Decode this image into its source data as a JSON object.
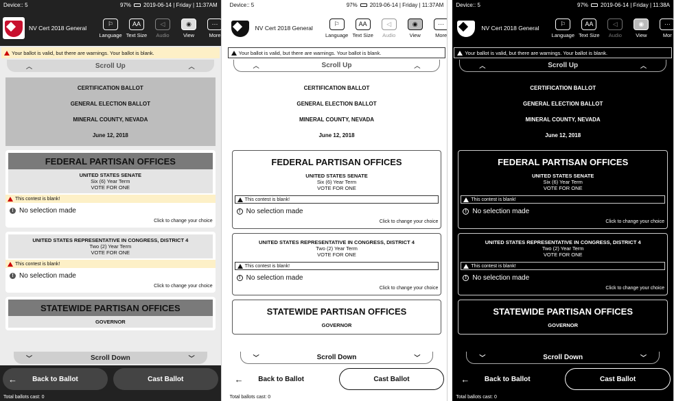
{
  "status": {
    "device": "Device:: 5",
    "battery": "97%",
    "datetime": "2019-06-14 | Friday | 11:37AM",
    "datetime_p3": "2019-06-14 | Friday | 11:38A"
  },
  "header": {
    "election": "NV Cert 2018 General",
    "tools": {
      "language": {
        "label": "Language",
        "icon": "flag-icon"
      },
      "text_size": {
        "label": "Text Size",
        "glyph": "AA"
      },
      "audio": {
        "label": "Audio",
        "icon": "speaker-icon"
      },
      "view": {
        "label": "View",
        "icon": "eye-icon"
      },
      "more": {
        "label": "More",
        "glyph": "···"
      },
      "more_p3": "Mor"
    }
  },
  "warning": "Your ballot is valid, but there are warnings. Your ballot is blank.",
  "scroll_up": "Scroll Up",
  "scroll_down": "Scroll Down",
  "ballot_header": {
    "line1": "CERTIFICATION BALLOT",
    "line2": "GENERAL ELECTION BALLOT",
    "line3": "MINERAL COUNTY, NEVADA",
    "date": "June 12, 2018"
  },
  "sections": [
    {
      "title": "FEDERAL PARTISAN OFFICES",
      "contest": {
        "name": "UNITED STATES SENATE",
        "term": "Six (6) Year Term",
        "vote": "VOTE FOR ONE",
        "blank": "This contest is blank!",
        "selection": "No selection made",
        "change": "Click to change your choice"
      }
    },
    {
      "title": "",
      "contest": {
        "name": "UNITED STATES REPRESENTATIVE IN CONGRESS, DISTRICT 4",
        "term": "Two (2) Year Term",
        "vote": "VOTE FOR ONE",
        "blank": "This contest is blank!",
        "selection": "No selection made",
        "change": "Click to change your choice"
      }
    },
    {
      "title": "STATEWIDE PARTISAN OFFICES",
      "partial": "GOVERNOR"
    }
  ],
  "buttons": {
    "back": "Back to Ballot",
    "cast": "Cast Ballot"
  },
  "footer": "Total ballots cast: 0",
  "themes": [
    "gray",
    "white",
    "black"
  ],
  "colors": {
    "warning_bg": "#fdf0c7",
    "brand_red": "#c8102e"
  }
}
